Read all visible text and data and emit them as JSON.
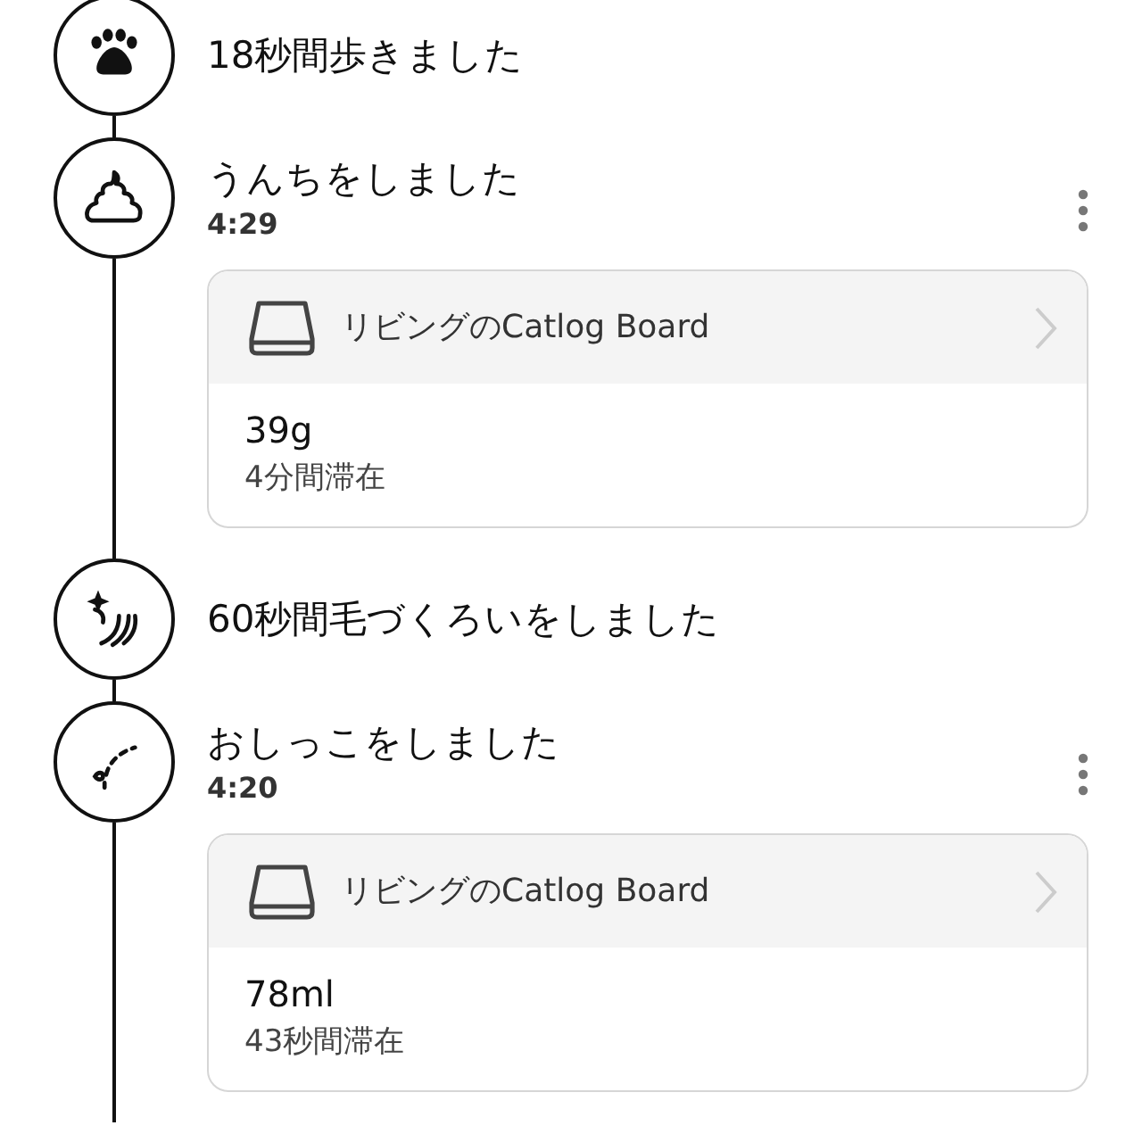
{
  "events": [
    {
      "kind": "walk",
      "title": "18秒間歩きました"
    },
    {
      "kind": "poop",
      "title": "うんちをしました",
      "time": "4:29",
      "device": {
        "name": "リビングのCatlog Board",
        "value": "39g",
        "duration": "4分間滞在"
      }
    },
    {
      "kind": "groom",
      "title": "60秒間毛づくろいをしました"
    },
    {
      "kind": "pee",
      "title": "おしっこをしました",
      "time": "4:20",
      "device": {
        "name": "リビングのCatlog Board",
        "value": "78ml",
        "duration": "43秒間滞在"
      }
    }
  ]
}
